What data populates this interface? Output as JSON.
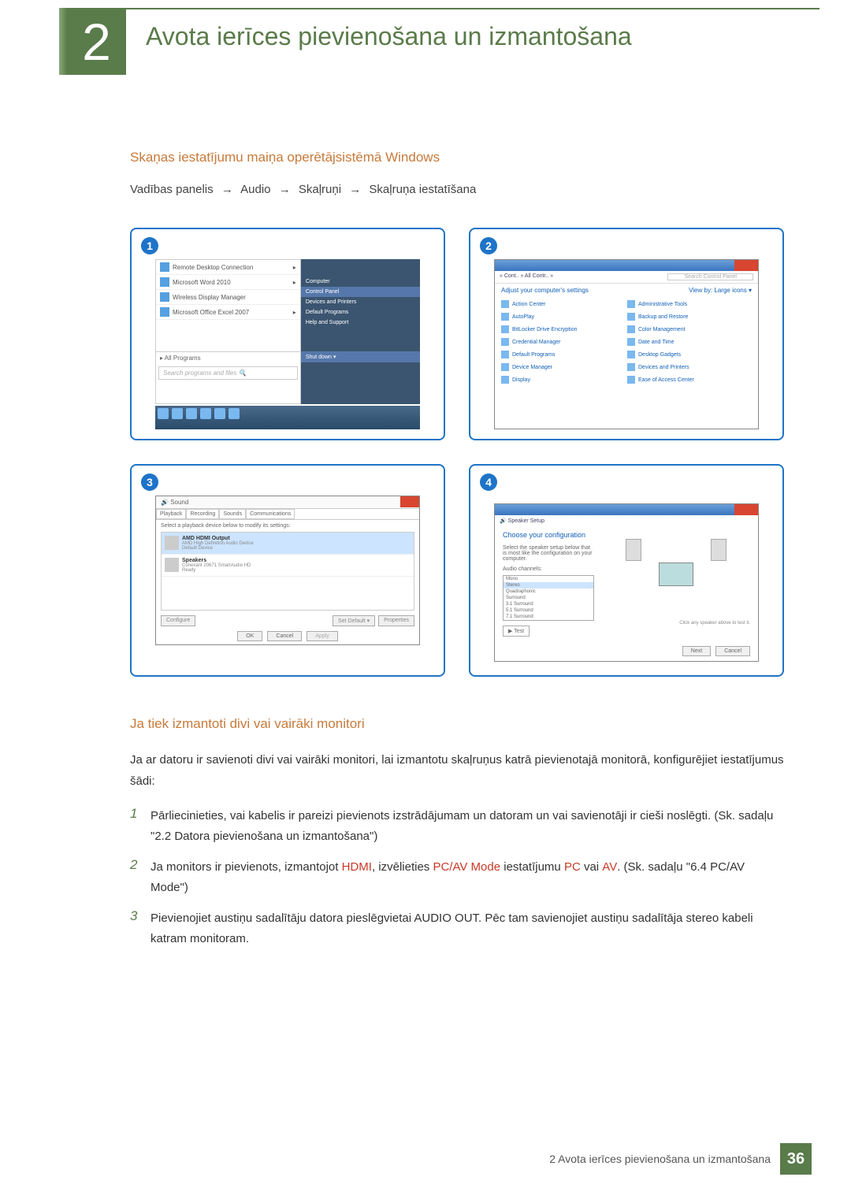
{
  "chapter": {
    "num": "2",
    "title": "Avota ierīces pievienošana un izmantošana"
  },
  "sec1": {
    "heading": "Skaņas iestatījumu maiņa operētājsistēmā Windows",
    "path": [
      "Vadības panelis",
      "Audio",
      "Skaļruņi",
      "Skaļruņa iestatīšana"
    ]
  },
  "panel1": {
    "num": "1",
    "left_items": [
      "Remote Desktop Connection",
      "Microsoft Word 2010",
      "Wireless Display Manager",
      "Microsoft Office Excel 2007"
    ],
    "all_programs": "All Programs",
    "search_placeholder": "Search programs and files",
    "right_items": [
      "Computer",
      "Control Panel",
      "Devices and Printers",
      "Default Programs",
      "Help and Support"
    ],
    "shutdown": "Shut down"
  },
  "panel2": {
    "num": "2",
    "addr": "« Cont.. » All Contr.. »",
    "search_ph": "Search Control Panel",
    "subtitle": "Adjust your computer's settings",
    "view": "View by: Large icons ▾",
    "items_left": [
      "Action Center",
      "AutoPlay",
      "BitLocker Drive Encryption",
      "Credential Manager",
      "Default Programs",
      "Device Manager",
      "Display"
    ],
    "items_right": [
      "Administrative Tools",
      "Backup and Restore",
      "Color Management",
      "Date and Time",
      "Desktop Gadgets",
      "Devices and Printers",
      "Ease of Access Center"
    ]
  },
  "panel3": {
    "num": "3",
    "title": "Sound",
    "tabs": [
      "Playback",
      "Recording",
      "Sounds",
      "Communications"
    ],
    "instr": "Select a playback device below to modify its settings:",
    "dev1": {
      "name": "AMD HDMI Output",
      "sub": "AMD High Definition Audio Device",
      "sub2": "Default Device"
    },
    "dev2": {
      "name": "Speakers",
      "sub": "Conexant 20671 SmartAudio HD",
      "sub2": "Ready"
    },
    "btns": {
      "cfg": "Configure",
      "def": "Set Default ▾",
      "prop": "Properties"
    },
    "foot": {
      "ok": "OK",
      "cancel": "Cancel",
      "apply": "Apply"
    }
  },
  "panel4": {
    "num": "4",
    "sub": "Speaker Setup",
    "head": "Choose your configuration",
    "instr": "Select the speaker setup below that is most like the configuration on your computer.",
    "ac_label": "Audio channels:",
    "opts": [
      "Mono",
      "Stereo",
      "Quadraphonic",
      "Surround",
      "3.1 Surround",
      "5.1 Surround",
      "7.1 Surround"
    ],
    "test": "▶ Test",
    "hint": "Click any speaker above to test it.",
    "foot": {
      "next": "Next",
      "cancel": "Cancel"
    }
  },
  "sec2": {
    "heading": "Ja tiek izmantoti divi vai vairāki monitori",
    "intro": "Ja ar datoru ir savienoti divi vai vairāki monitori, lai izmantotu skaļruņus katrā pievienotajā monitorā, konfigurējiet iestatījumus šādi:",
    "items": [
      {
        "n": "1",
        "t": "Pārliecinieties, vai kabelis ir pareizi pievienots izstrādājumam un datoram un vai savienotāji ir cieši noslēgti. (Sk. sadaļu \"2.2 Datora pievienošana un izmantošana\")"
      },
      {
        "n": "2",
        "pre": "Ja monitors ir pievienots, izmantojot ",
        "r1": "HDMI",
        "mid1": ", izvēlieties ",
        "r2": "PC/AV Mode",
        "mid2": " iestatījumu ",
        "r3": "PC",
        "mid3": " vai ",
        "r4": "AV",
        "post": ". (Sk. sadaļu \"6.4 PC/AV Mode\")"
      },
      {
        "n": "3",
        "t": "Pievienojiet austiņu sadalītāju datora pieslēgvietai AUDIO OUT. Pēc tam savienojiet austiņu sadalītāja stereo kabeli katram monitoram."
      }
    ]
  },
  "footer": {
    "text": "2 Avota ierīces pievienošana un izmantošana",
    "page": "36"
  }
}
